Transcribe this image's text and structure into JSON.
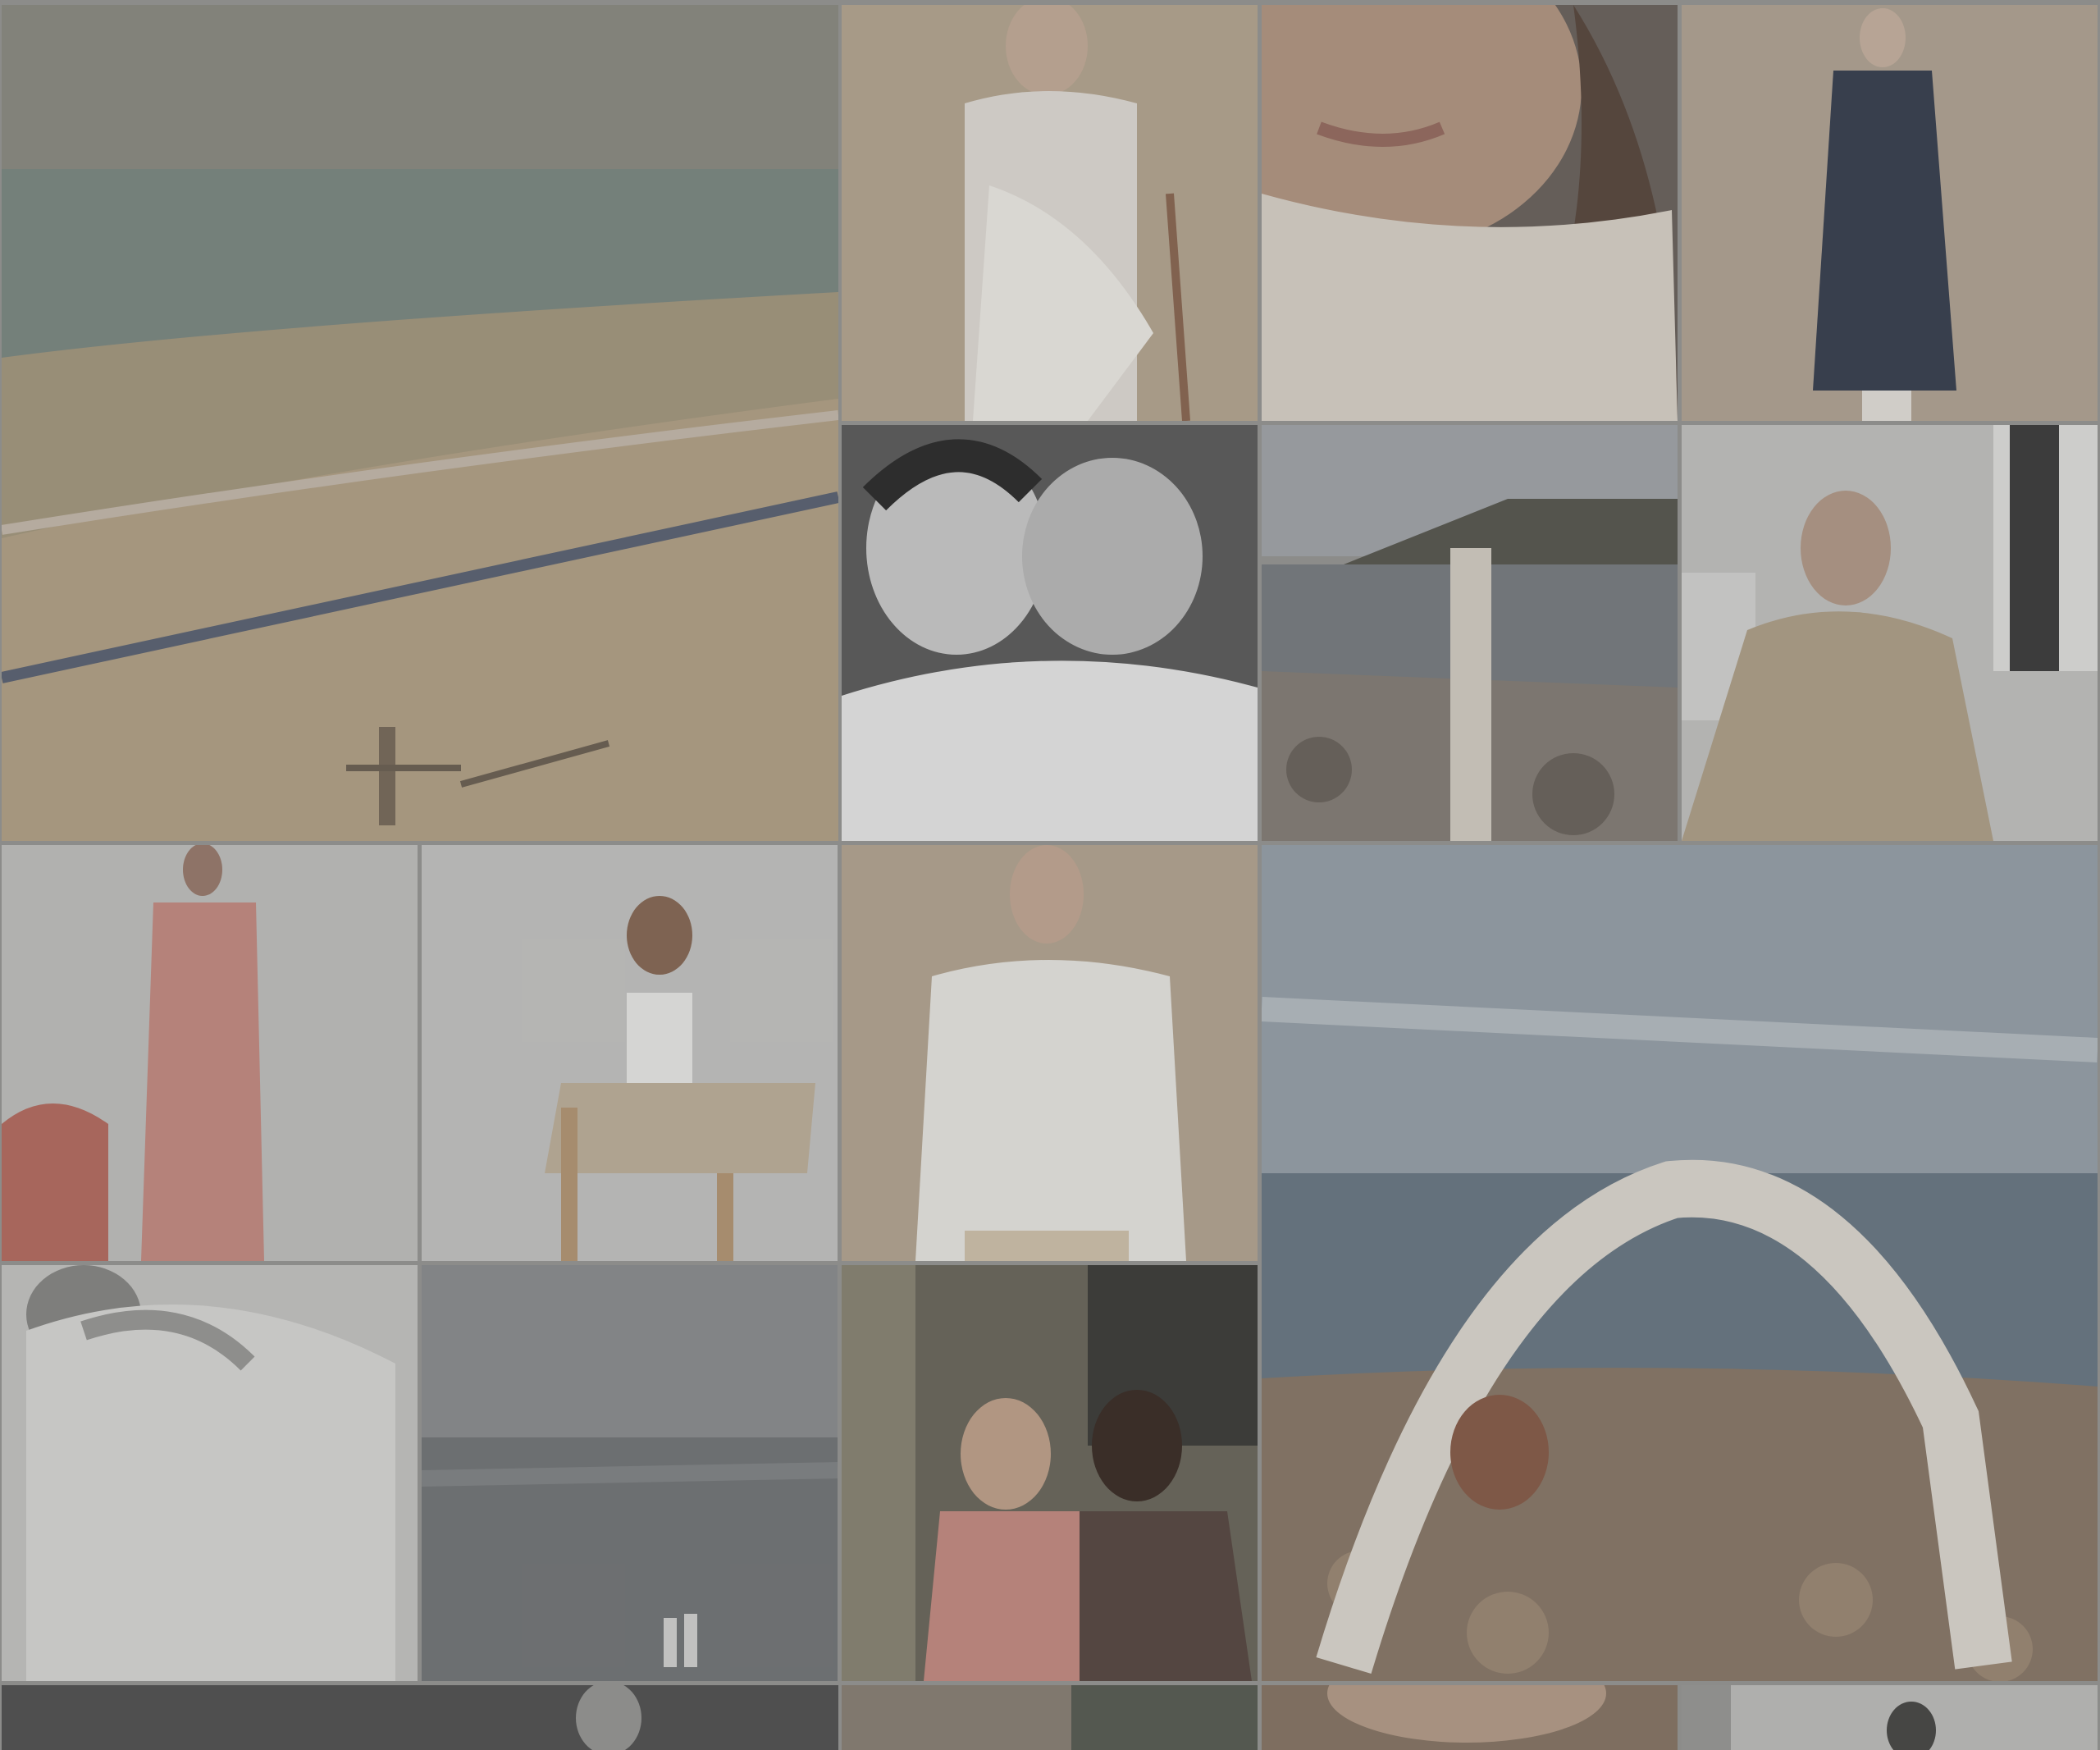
{
  "gallery": {
    "tiles": [
      {
        "subject": "beach-shoreline"
      },
      {
        "subject": "model-seated-white-dress"
      },
      {
        "subject": "closeup-face-knit"
      },
      {
        "subject": "model-navy-trench"
      },
      {
        "subject": "two-models-laughing-bw"
      },
      {
        "subject": "woman-rocky-coast"
      },
      {
        "subject": "model-beige-trench-studio"
      },
      {
        "subject": "model-pink-suit"
      },
      {
        "subject": "model-seated-chair-white-top"
      },
      {
        "subject": "model-white-shirt"
      },
      {
        "subject": "woman-backbend-beach"
      },
      {
        "subject": "couple-embrace-white-jacket"
      },
      {
        "subject": "seascape-two-figures"
      },
      {
        "subject": "two-women-laughing-street"
      },
      {
        "subject": "partial-dark-tile"
      },
      {
        "subject": "partial-window-tile"
      },
      {
        "subject": "partial-face-tile"
      },
      {
        "subject": "partial-studio-tile"
      }
    ]
  },
  "colors": {
    "page_bg": "#9a9a98",
    "sand": "#b7a68a",
    "sea": "#8c9792",
    "studio_beige": "#b9aa95",
    "studio_grey": "#bdbdbb",
    "navy": "#3b4252",
    "pink": "#c98f86"
  }
}
